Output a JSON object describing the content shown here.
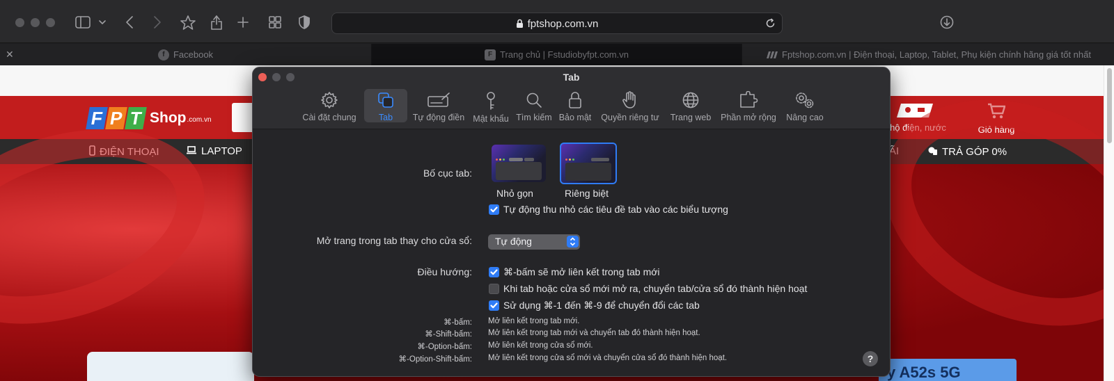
{
  "browser": {
    "url": "fptshop.com.vn",
    "tabs": [
      {
        "label": "Facebook",
        "favicon": "f"
      },
      {
        "label": "Trang chủ | Fstudiobyfpt.com.vn",
        "favicon": "F"
      },
      {
        "label": "Fptshop.com.vn | Điện thoại, Laptop, Tablet, Phụ kiện chính hãng giá tốt nhất",
        "favicon": ""
      }
    ]
  },
  "webpage": {
    "logo_text": "Shop",
    "logo_suffix": ".com.vn",
    "logo_letters": [
      "F",
      "P",
      "T"
    ],
    "header_right": {
      "bill_label": "hu hộ điện, nước",
      "cart_label": "Giỏ hàng"
    },
    "nav": {
      "phone": "ĐIỆN THOẠI",
      "laptop": "LAPTOP",
      "promo": "ÃI",
      "installment": "TRẢ GÓP 0%"
    },
    "banner_text": "y A52s 5G",
    "brand_color": "#c21d1d"
  },
  "prefs": {
    "title": "Tab",
    "tabs": [
      {
        "label": "Cài đặt chung",
        "icon": "gear-icon"
      },
      {
        "label": "Tab",
        "icon": "tabs-icon"
      },
      {
        "label": "Tự động điền",
        "icon": "autofill-icon"
      },
      {
        "label": "Mật khẩu",
        "icon": "key-icon"
      },
      {
        "label": "Tìm kiếm",
        "icon": "search-icon"
      },
      {
        "label": "Bảo mật",
        "icon": "lock-icon"
      },
      {
        "label": "Quyền riêng tư",
        "icon": "hand-icon"
      },
      {
        "label": "Trang web",
        "icon": "globe-icon"
      },
      {
        "label": "Phần mở rộng",
        "icon": "puzzle-icon"
      },
      {
        "label": "Nâng cao",
        "icon": "gears-icon"
      }
    ],
    "layout_label": "Bố cục tab:",
    "layout_options": [
      "Nhỏ gọn",
      "Riêng biệt"
    ],
    "layout_selected": "Riêng biệt",
    "auto_shrink_label": "Tự động thu nhỏ các tiêu đề tab vào các biểu tượng",
    "auto_shrink_checked": true,
    "open_pages_label": "Mở trang trong tab thay cho cửa sổ:",
    "open_pages_value": "Tự động",
    "nav_label": "Điều hướng:",
    "nav_options": [
      {
        "label": "⌘-bấm sẽ mở liên kết trong tab mới",
        "checked": true
      },
      {
        "label": "Khi tab hoặc cửa sổ mới mở ra, chuyển tab/cửa sổ đó thành hiện hoạt",
        "checked": false
      },
      {
        "label": "Sử dụng ⌘-1 đến ⌘-9 để chuyển đổi các tab",
        "checked": true
      }
    ],
    "shortcuts": [
      {
        "key": "⌘-bấm:",
        "desc": "Mở liên kết trong tab mới."
      },
      {
        "key": "⌘-Shift-bấm:",
        "desc": "Mở liên kết trong tab mới và chuyển tab đó thành hiện hoạt."
      },
      {
        "key": "⌘-Option-bấm:",
        "desc": "Mở liên kết trong cửa sổ mới."
      },
      {
        "key": "⌘-Option-Shift-bấm:",
        "desc": "Mở liên kết trong cửa sổ mới và chuyển cửa sổ đó thành hiện hoạt."
      }
    ],
    "help": "?",
    "accent": "#2f7cf6"
  }
}
